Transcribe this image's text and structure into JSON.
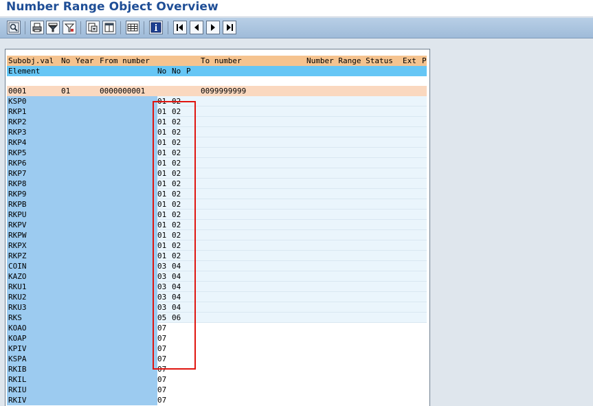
{
  "window": {
    "title": "Number Range Object Overview"
  },
  "toolbar": {
    "buttons": [
      {
        "name": "detail-view",
        "icon": "magnifier-icon"
      },
      {
        "name": "print",
        "icon": "printer-icon"
      },
      {
        "name": "set-filter",
        "icon": "funnel-icon"
      },
      {
        "name": "filter-options",
        "icon": "funnel-settings-icon"
      },
      {
        "name": "export",
        "icon": "export-icon"
      },
      {
        "name": "layout",
        "icon": "layout-icon"
      },
      {
        "name": "grid-view",
        "icon": "grid-icon"
      },
      {
        "name": "information",
        "icon": "info-icon"
      },
      {
        "name": "first-page",
        "icon": "first-page-icon"
      },
      {
        "name": "previous-page",
        "icon": "previous-page-icon"
      },
      {
        "name": "next-page",
        "icon": "next-page-icon"
      },
      {
        "name": "last-page",
        "icon": "last-page-icon"
      }
    ]
  },
  "list": {
    "header1": {
      "subobj": "Subobj.val",
      "no": "No",
      "year": "Year",
      "from": "From number",
      "to": "To number",
      "status": "Number Range Status",
      "ext": "Ext",
      "p": "P"
    },
    "header2": {
      "element": "Element",
      "no1": "No",
      "no2": "No",
      "p": "P"
    },
    "level1": {
      "subobj": "0001",
      "no": "01",
      "from": "0000000001",
      "to": "0099999999"
    },
    "rows": [
      {
        "key": "KSP0",
        "v1": "01",
        "v2": "02"
      },
      {
        "key": "RKP1",
        "v1": "01",
        "v2": "02"
      },
      {
        "key": "RKP2",
        "v1": "01",
        "v2": "02"
      },
      {
        "key": "RKP3",
        "v1": "01",
        "v2": "02"
      },
      {
        "key": "RKP4",
        "v1": "01",
        "v2": "02"
      },
      {
        "key": "RKP5",
        "v1": "01",
        "v2": "02"
      },
      {
        "key": "RKP6",
        "v1": "01",
        "v2": "02"
      },
      {
        "key": "RKP7",
        "v1": "01",
        "v2": "02"
      },
      {
        "key": "RKP8",
        "v1": "01",
        "v2": "02"
      },
      {
        "key": "RKP9",
        "v1": "01",
        "v2": "02"
      },
      {
        "key": "RKPB",
        "v1": "01",
        "v2": "02"
      },
      {
        "key": "RKPU",
        "v1": "01",
        "v2": "02"
      },
      {
        "key": "RKPV",
        "v1": "01",
        "v2": "02"
      },
      {
        "key": "RKPW",
        "v1": "01",
        "v2": "02"
      },
      {
        "key": "RKPX",
        "v1": "01",
        "v2": "02"
      },
      {
        "key": "RKPZ",
        "v1": "01",
        "v2": "02"
      },
      {
        "key": "COIN",
        "v1": "03",
        "v2": "04"
      },
      {
        "key": "KAZO",
        "v1": "03",
        "v2": "04"
      },
      {
        "key": "RKU1",
        "v1": "03",
        "v2": "04"
      },
      {
        "key": "RKU2",
        "v1": "03",
        "v2": "04"
      },
      {
        "key": "RKU3",
        "v1": "03",
        "v2": "04"
      },
      {
        "key": "RKS",
        "v1": "05",
        "v2": "06"
      },
      {
        "key": "KOAO",
        "v1": "07",
        "v2": ""
      },
      {
        "key": "KOAP",
        "v1": "07",
        "v2": ""
      },
      {
        "key": "KPIV",
        "v1": "07",
        "v2": ""
      },
      {
        "key": "KSPA",
        "v1": "07",
        "v2": ""
      },
      {
        "key": "RKIB",
        "v1": "07",
        "v2": ""
      },
      {
        "key": "RKIL",
        "v1": "07",
        "v2": ""
      },
      {
        "key": "RKIU",
        "v1": "07",
        "v2": ""
      },
      {
        "key": "RKIV",
        "v1": "07",
        "v2": ""
      }
    ]
  },
  "colors": {
    "highlight": "#e0140e",
    "header1": "#f5c38f",
    "header2": "#66c6f5",
    "key_column": "#9ccbf0",
    "level1": "#fad8bf"
  }
}
